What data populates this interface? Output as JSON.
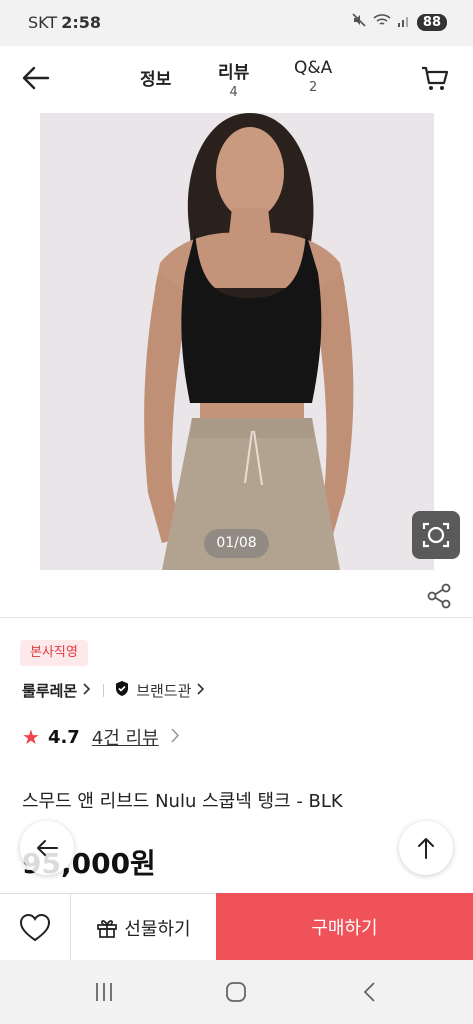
{
  "status": {
    "carrier": "SKT",
    "time": "2:58",
    "battery": "88"
  },
  "header": {
    "tabs": [
      {
        "label": "정보",
        "count": ""
      },
      {
        "label": "리뷰",
        "count": "4"
      },
      {
        "label": "Q&A",
        "count": "2"
      }
    ]
  },
  "gallery": {
    "pager": "01/08"
  },
  "product": {
    "badge": "본사직영",
    "brand": "룰루레몬",
    "brand_hall": "브랜드관",
    "rating": "4.7",
    "review_link": "4건 리뷰",
    "title": "스무드 앤 리브드 Nulu 스쿱넥 탱크 - BLK",
    "price": "95,000원"
  },
  "actions": {
    "gift": "선물하기",
    "buy": "구매하기"
  },
  "colors": {
    "accent": "#f0525a",
    "badge_text": "#e5383f",
    "badge_bg": "#fde9ea"
  },
  "icons": [
    "back-arrow-icon",
    "cart-icon",
    "lens-search-icon",
    "share-icon",
    "heart-icon",
    "gift-icon",
    "arrow-up-icon"
  ]
}
